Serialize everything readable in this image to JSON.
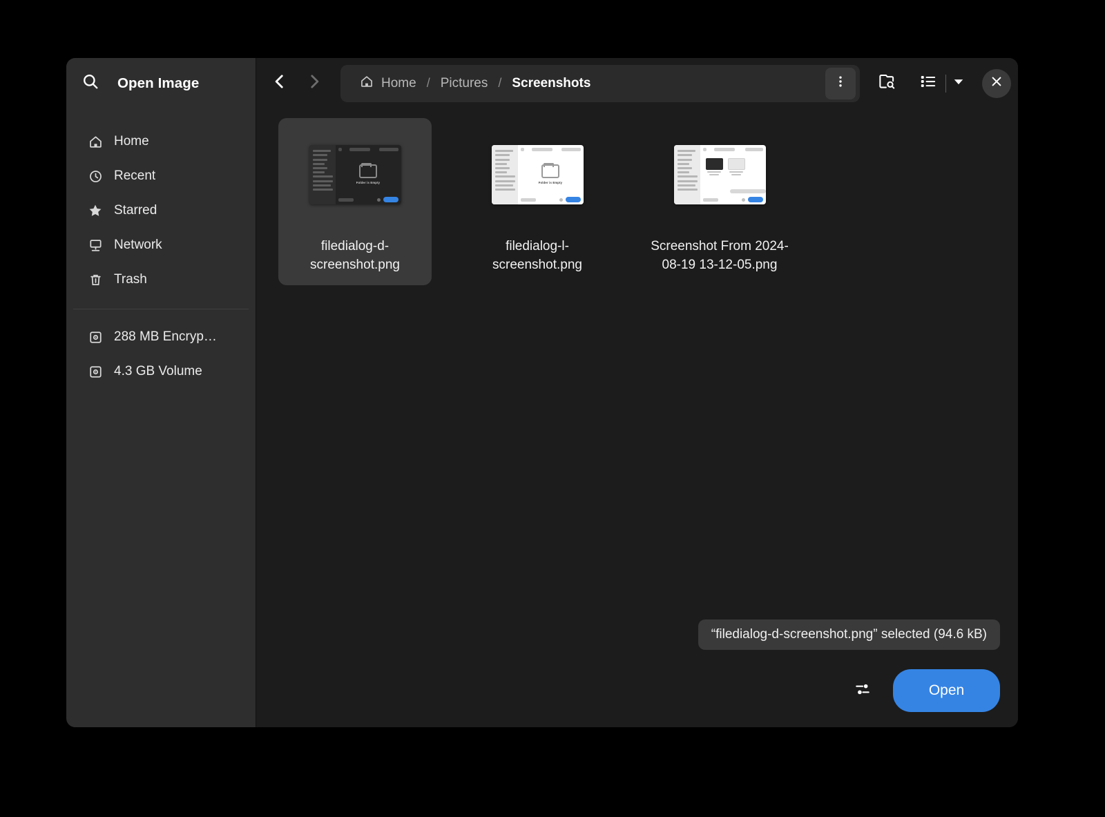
{
  "dialog": {
    "title": "Open Image"
  },
  "sidebar": {
    "search_icon": "search-icon",
    "items": [
      {
        "label": "Home",
        "icon": "home-icon"
      },
      {
        "label": "Recent",
        "icon": "clock-icon"
      },
      {
        "label": "Starred",
        "icon": "star-icon"
      },
      {
        "label": "Network",
        "icon": "network-icon"
      },
      {
        "label": "Trash",
        "icon": "trash-icon"
      }
    ],
    "volumes": [
      {
        "label": "288 MB Encryp…",
        "icon": "drive-icon"
      },
      {
        "label": "4.3 GB Volume",
        "icon": "drive-icon"
      }
    ]
  },
  "header": {
    "back_icon": "chevron-left-icon",
    "forward_icon": "chevron-right-icon",
    "breadcrumb": [
      {
        "label": "Home",
        "icon": "home-icon",
        "current": false
      },
      {
        "label": "Pictures",
        "icon": "",
        "current": false
      },
      {
        "label": "Screenshots",
        "icon": "",
        "current": true
      }
    ],
    "separator": "/",
    "kebab_icon": "kebab-menu-icon",
    "search_folder_icon": "folder-search-icon",
    "view_list_icon": "list-view-icon",
    "view_dropdown_icon": "chevron-down-icon",
    "close_icon": "close-icon"
  },
  "files": [
    {
      "name": "filedialog-d-screenshot.png",
      "selected": true,
      "thumb_kind": "dialog-dark",
      "thumb_caption": "Folder is Empty"
    },
    {
      "name": "filedialog-l-screenshot.png",
      "selected": false,
      "thumb_kind": "dialog-light",
      "thumb_caption": "Folder is Empty"
    },
    {
      "name": "Screenshot From 2024-08-19 13-12-05.png",
      "selected": false,
      "thumb_kind": "dialog-light-files",
      "thumb_caption": ""
    }
  ],
  "footer": {
    "status_text": "“filedialog-d-screenshot.png” selected  (94.6 kB)",
    "filter_icon": "filter-settings-icon",
    "open_label": "Open"
  },
  "colors": {
    "accent": "#3584e4",
    "window_bg": "#1c1c1c",
    "sidebar_bg": "#2e2e2e",
    "selection_bg": "#3a3a3a",
    "text": "#ffffff"
  }
}
